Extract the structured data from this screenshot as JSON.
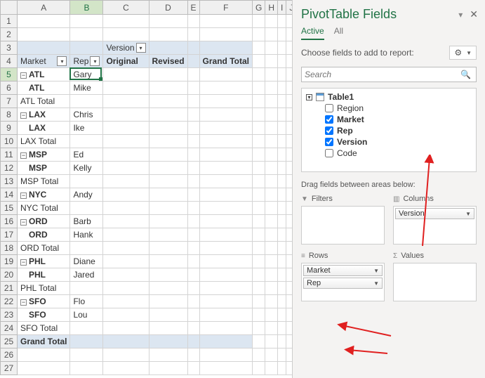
{
  "columns": [
    "A",
    "B",
    "C",
    "D",
    "E",
    "F",
    "G",
    "H",
    "I",
    "J"
  ],
  "rowcount": 27,
  "active_cell": {
    "row": 5,
    "col": "B"
  },
  "pivot": {
    "version_header_row": 3,
    "version_header_col": "C",
    "version_label": "Version",
    "col_labels_row": 4,
    "market_label": "Market",
    "rep_label": "Rep",
    "col_headers": [
      "Original",
      "Revised",
      "Grand Total"
    ],
    "rows": [
      {
        "r": 5,
        "market": "ATL",
        "collapse": true,
        "rep": "Gary",
        "bold": true
      },
      {
        "r": 6,
        "market": "ATL",
        "rep": "Mike",
        "bold": true
      },
      {
        "r": 7,
        "total_label": "ATL Total"
      },
      {
        "r": 8,
        "market": "LAX",
        "collapse": true,
        "rep": "Chris",
        "bold": true
      },
      {
        "r": 9,
        "market": "LAX",
        "rep": "Ike",
        "bold": true
      },
      {
        "r": 10,
        "total_label": "LAX Total"
      },
      {
        "r": 11,
        "market": "MSP",
        "collapse": true,
        "rep": "Ed",
        "bold": true
      },
      {
        "r": 12,
        "market": "MSP",
        "rep": "Kelly",
        "bold": true
      },
      {
        "r": 13,
        "total_label": "MSP Total"
      },
      {
        "r": 14,
        "market": "NYC",
        "collapse": true,
        "rep": "Andy",
        "bold": true
      },
      {
        "r": 15,
        "total_label": "NYC Total"
      },
      {
        "r": 16,
        "market": "ORD",
        "collapse": true,
        "rep": "Barb",
        "bold": true
      },
      {
        "r": 17,
        "market": "ORD",
        "rep": "Hank",
        "bold": true
      },
      {
        "r": 18,
        "total_label": "ORD Total"
      },
      {
        "r": 19,
        "market": "PHL",
        "collapse": true,
        "rep": "Diane",
        "bold": true
      },
      {
        "r": 20,
        "market": "PHL",
        "rep": "Jared",
        "bold": true
      },
      {
        "r": 21,
        "total_label": "PHL Total"
      },
      {
        "r": 22,
        "market": "SFO",
        "collapse": true,
        "rep": "Flo",
        "bold": true
      },
      {
        "r": 23,
        "market": "SFO",
        "rep": "Lou",
        "bold": true
      },
      {
        "r": 24,
        "total_label": "SFO Total"
      },
      {
        "r": 25,
        "grand_total": "Grand Total"
      }
    ]
  },
  "taskpane": {
    "title": "PivotTable Fields",
    "tabs": [
      "Active",
      "All"
    ],
    "active_tab": "Active",
    "choose_label": "Choose fields to add to report:",
    "search_placeholder": "Search",
    "table_name": "Table1",
    "fields": [
      {
        "name": "Region",
        "checked": false
      },
      {
        "name": "Market",
        "checked": true
      },
      {
        "name": "Rep",
        "checked": true
      },
      {
        "name": "Version",
        "checked": true
      },
      {
        "name": "Code",
        "checked": false
      }
    ],
    "drag_label": "Drag fields between areas below:",
    "areas": {
      "filters": {
        "label": "Filters",
        "items": []
      },
      "columns": {
        "label": "Columns",
        "items": [
          "Version"
        ]
      },
      "rows": {
        "label": "Rows",
        "items": [
          "Market",
          "Rep"
        ]
      },
      "values": {
        "label": "Values",
        "items": []
      }
    }
  }
}
